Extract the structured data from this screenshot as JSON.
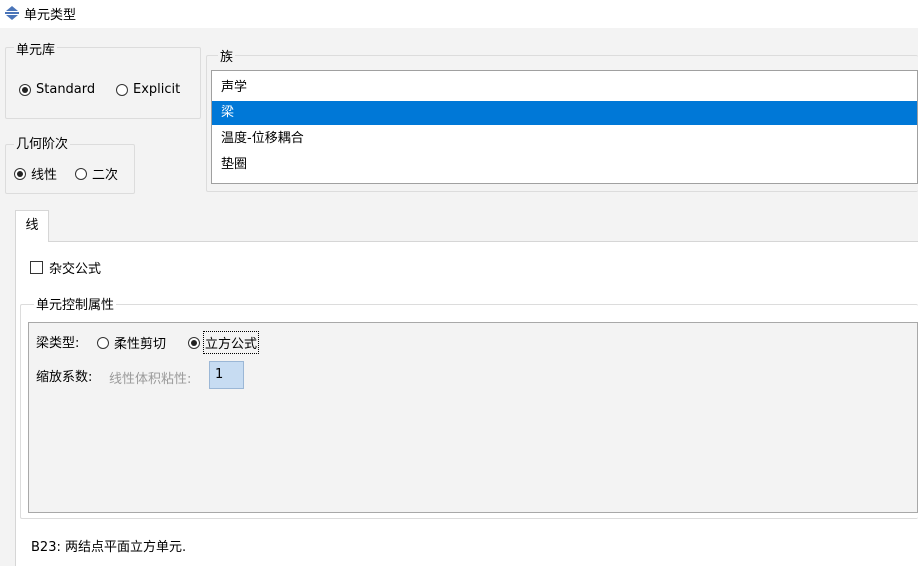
{
  "window": {
    "title": "单元类型",
    "icon": "stacked-arrows-icon"
  },
  "library": {
    "legend": "单元库",
    "options": [
      "Standard",
      "Explicit"
    ],
    "selected": "Standard"
  },
  "geometric_order": {
    "legend": "几何阶次",
    "options": [
      "线性",
      "二次"
    ],
    "selected": "线性"
  },
  "family": {
    "legend": "族",
    "items": [
      "声学",
      "梁",
      "温度-位移耦合",
      "垫圈"
    ],
    "selected": "梁"
  },
  "tabs": [
    {
      "label": "线",
      "active": true
    }
  ],
  "hybrid": {
    "label": "杂交公式",
    "checked": false
  },
  "element_controls": {
    "legend": "单元控制属性",
    "beam_type_label": "梁类型:",
    "beam_type_options": [
      "柔性剪切",
      "立方公式"
    ],
    "beam_type_selected": "立方公式",
    "scaling_label": "缩放系数:",
    "bulk_viscosity_label": "线性体积粘性:",
    "bulk_viscosity_value": "1"
  },
  "description": "B23:  两结点平面立方单元."
}
